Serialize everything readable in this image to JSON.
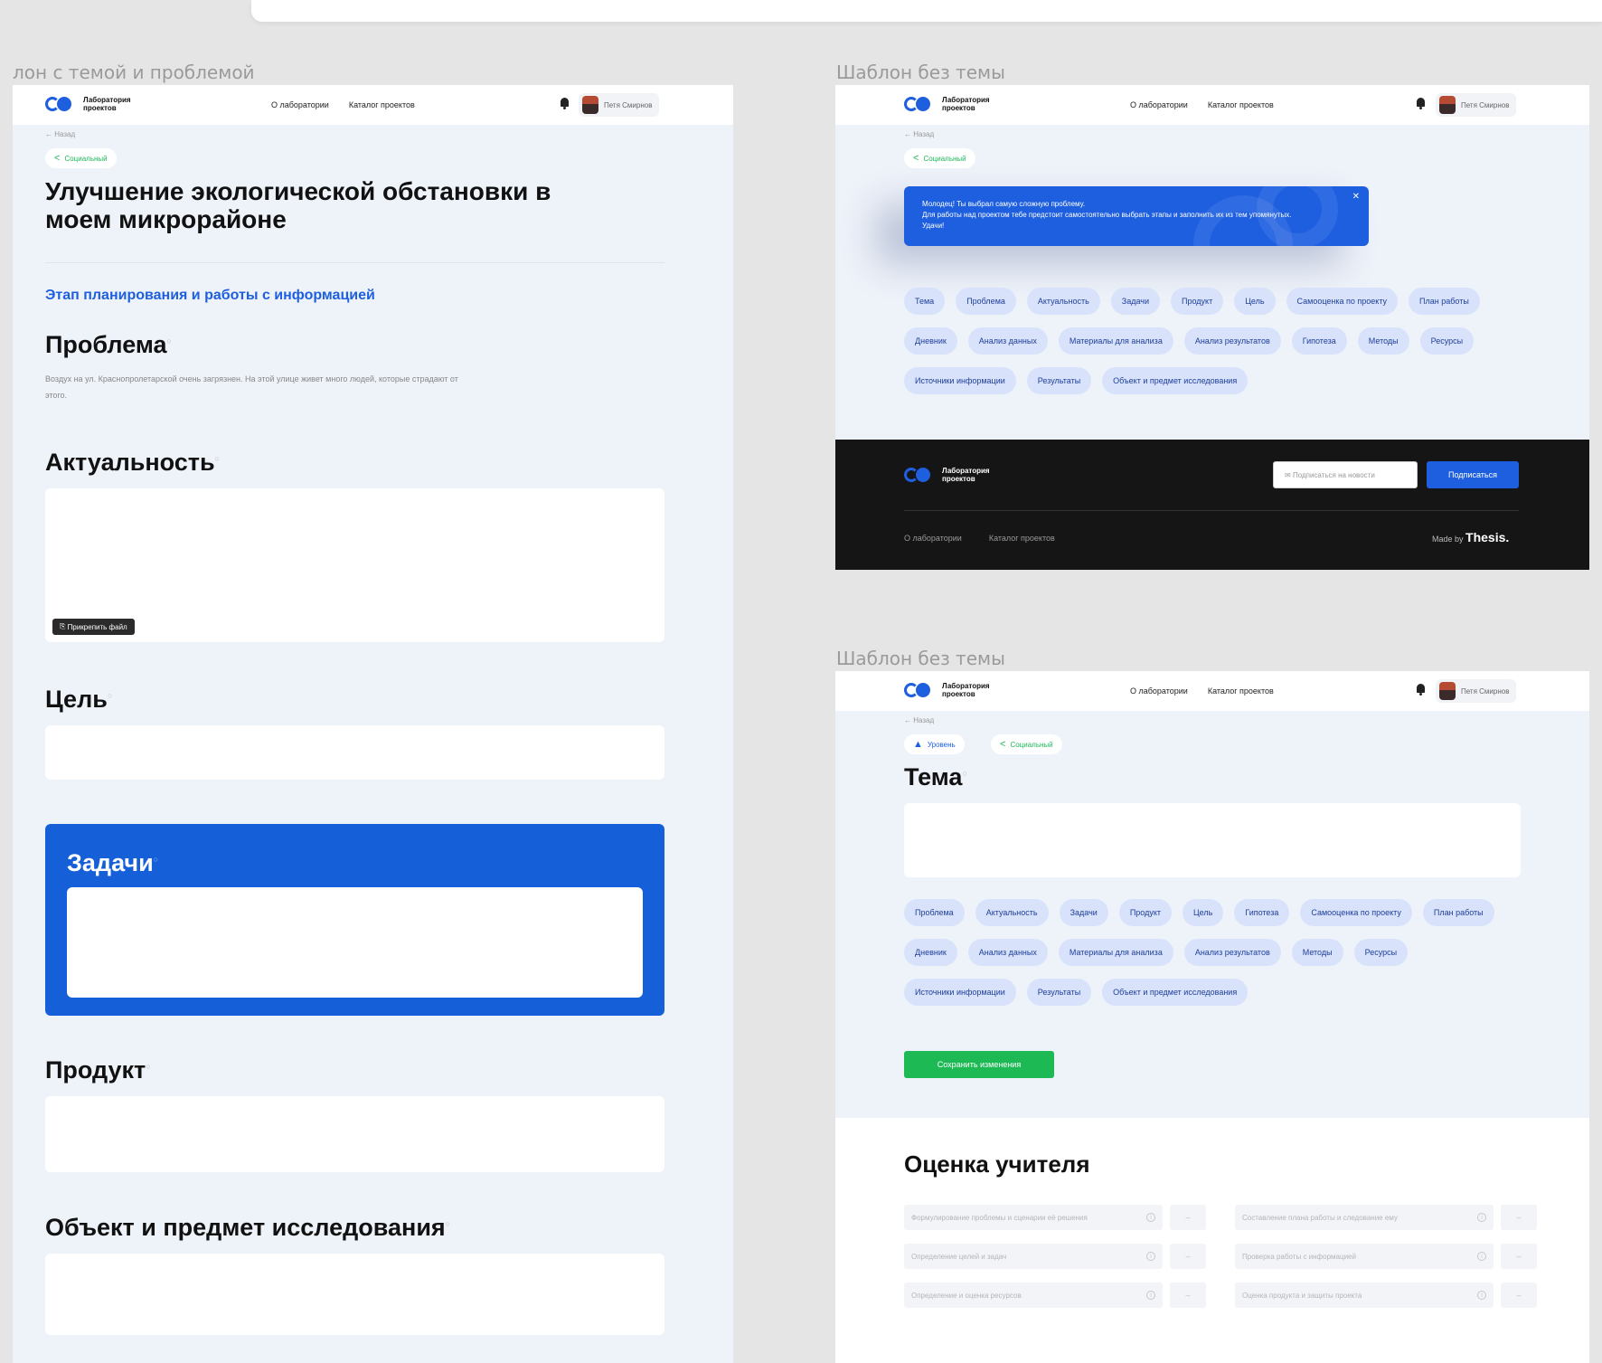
{
  "labels": {
    "left": "лон с темой и проблемой",
    "right_top": "Шаблон без темы",
    "right_bottom": "Шаблон без темы"
  },
  "header": {
    "logo": "Лаборатория проектов",
    "nav": [
      "О лаборатории",
      "Каталог проектов"
    ],
    "user": "Петя Смирнов"
  },
  "left": {
    "breadcrumb": "← Назад",
    "badge": "Социальный",
    "title": "Улучшение экологической обстановки в моем микрорайоне",
    "stage": "Этап планирования и работы с информацией",
    "problem_title": "Проблема",
    "problem_text": "Воздух на ул. Краснопролетарской очень загрязнен. На этой улице живет много людей, которые страдают от этого.",
    "relevance_title": "Актуальность",
    "attach_label": "Прикрепить файл",
    "goal_title": "Цель",
    "tasks_title": "Задачи",
    "product_title": "Продукт",
    "object_title": "Объект и предмет исследования"
  },
  "right_top": {
    "breadcrumb": "← Назад",
    "badge": "Социальный",
    "banner_line1": "Молодец! Ты выбрал самую сложную проблему.",
    "banner_line2": "Для работы над проектом тебе предстоит самостоятельно выбрать этапы и заполнить их из тем упомянутых. Удачи!",
    "chips": [
      "Тема",
      "Проблема",
      "Актуальность",
      "Задачи",
      "Продукт",
      "Цель",
      "Самооценка по проекту",
      "План работы",
      "Дневник",
      "Анализ данных",
      "Материалы для анализа",
      "Анализ результатов",
      "Гипотеза",
      "Методы",
      "Ресурсы",
      "Источники информации",
      "Результаты",
      "Объект и предмет исследования"
    ],
    "footer_logo": "Лаборатория проектов",
    "subscribe_placeholder": "Подписаться на новости",
    "subscribe_button": "Подписаться",
    "footer_nav": [
      "О лаборатории",
      "Каталог проектов"
    ],
    "made_by": "Made by",
    "made_brand": "Thesis."
  },
  "right_bottom": {
    "breadcrumb": "← Назад",
    "badge1": "Уровень",
    "badge2": "Социальный",
    "theme_title": "Тема",
    "chips": [
      "Проблема",
      "Актуальность",
      "Задачи",
      "Продукт",
      "Цель",
      "Гипотеза",
      "Самооценка по проекту",
      "План работы",
      "Дневник",
      "Анализ данных",
      "Материалы для анализа",
      "Анализ результатов",
      "Методы",
      "Ресурсы",
      "Источники информации",
      "Результаты",
      "Объект и предмет исследования"
    ],
    "save_button": "Сохранить изменения",
    "grade_title": "Оценка учителя",
    "grade_fields": [
      "Формулирование проблемы и сценарии её решения",
      "Составление плана работы и следование ему",
      "Определение целей и задач",
      "Проверка работы с информацией",
      "Определение и оценка ресурсов",
      "Оценка продукта и защиты проекта"
    ],
    "grade_select": "–"
  }
}
